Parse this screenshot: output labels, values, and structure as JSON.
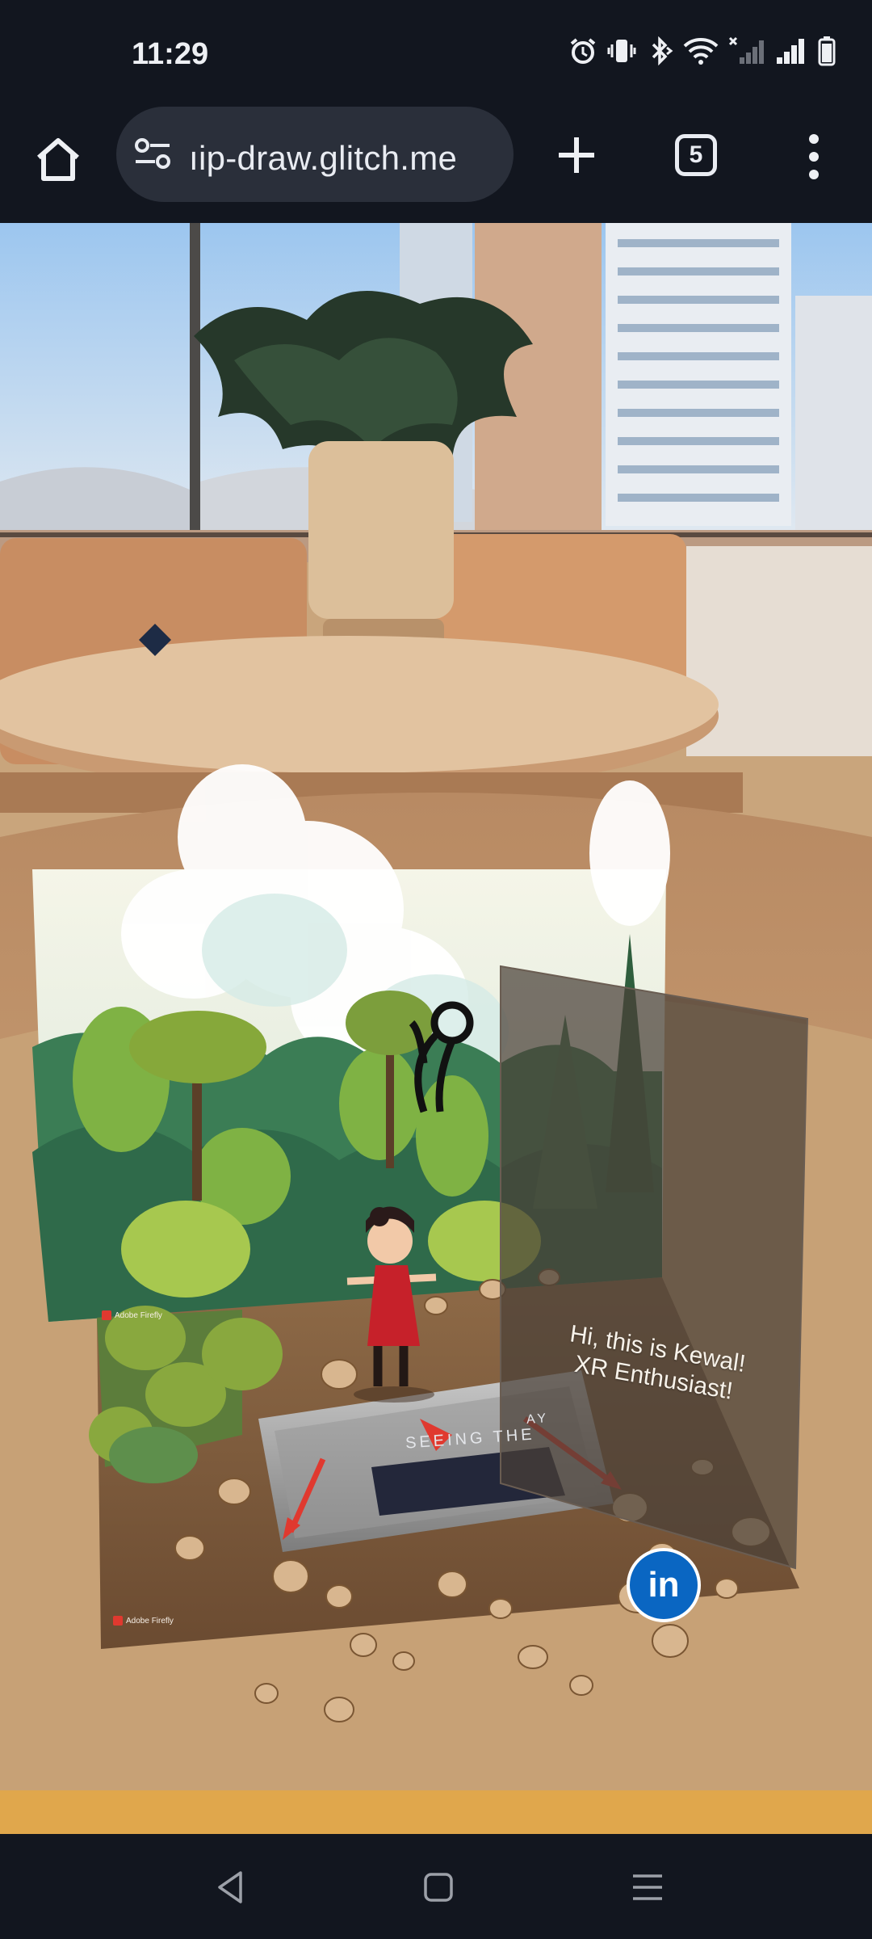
{
  "status_bar": {
    "time": "11:29",
    "icons": [
      "alarm-icon",
      "vibrate-icon",
      "bluetooth-icon",
      "wifi-icon",
      "signal-sim1-icon",
      "signal-sim2-icon",
      "battery-icon"
    ]
  },
  "toolbar": {
    "url": "ıip-draw.glitch.me",
    "tab_count": "5",
    "icons": [
      "home-icon",
      "site-settings-icon",
      "new-tab-icon",
      "tab-switcher-icon",
      "more-menu-icon"
    ]
  },
  "ar_scene": {
    "greeting_line1": "Hi, this is Kewal!",
    "greeting_line2": "XR Enthusiast!",
    "linkedin_label": "in",
    "watermark": "Adobe Firefly",
    "sign_text": "SEEING THE",
    "sign_suffix": "AY",
    "colors": {
      "linkedin": "#0a66c2",
      "arrow": "#e0392f",
      "character_dress": "#c6212a"
    }
  },
  "nav_bar": {
    "icons": [
      "back-icon",
      "home-square-icon",
      "recents-icon"
    ]
  }
}
